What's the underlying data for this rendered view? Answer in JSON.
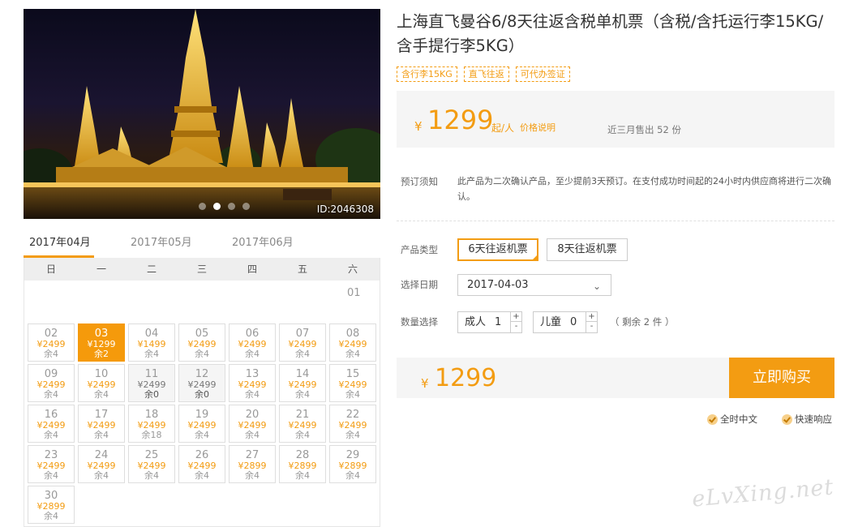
{
  "hero": {
    "id_label": "ID:2046308",
    "dot_count": 4,
    "active_dot": 1
  },
  "calendar": {
    "tabs": [
      "2017年04月",
      "2017年05月",
      "2017年06月"
    ],
    "active_tab": 0,
    "weekdays": [
      "日",
      "一",
      "二",
      "三",
      "四",
      "五",
      "六"
    ],
    "first_day": "01",
    "days": [
      {
        "d": "02",
        "p": "¥2499",
        "r": "余4"
      },
      {
        "d": "03",
        "p": "¥1299",
        "r": "余2",
        "state": "selected"
      },
      {
        "d": "04",
        "p": "¥1499",
        "r": "余4"
      },
      {
        "d": "05",
        "p": "¥2499",
        "r": "余4"
      },
      {
        "d": "06",
        "p": "¥2499",
        "r": "余4"
      },
      {
        "d": "07",
        "p": "¥2499",
        "r": "余4"
      },
      {
        "d": "08",
        "p": "¥2499",
        "r": "余4"
      },
      {
        "d": "09",
        "p": "¥2499",
        "r": "余4"
      },
      {
        "d": "10",
        "p": "¥2499",
        "r": "余4"
      },
      {
        "d": "11",
        "p": "¥2499",
        "r": "余0",
        "state": "soldout"
      },
      {
        "d": "12",
        "p": "¥2499",
        "r": "余0",
        "state": "soldout"
      },
      {
        "d": "13",
        "p": "¥2499",
        "r": "余4"
      },
      {
        "d": "14",
        "p": "¥2499",
        "r": "余4"
      },
      {
        "d": "15",
        "p": "¥2499",
        "r": "余4"
      },
      {
        "d": "16",
        "p": "¥2499",
        "r": "余4"
      },
      {
        "d": "17",
        "p": "¥2499",
        "r": "余4"
      },
      {
        "d": "18",
        "p": "¥2499",
        "r": "余18"
      },
      {
        "d": "19",
        "p": "¥2499",
        "r": "余4"
      },
      {
        "d": "20",
        "p": "¥2499",
        "r": "余4"
      },
      {
        "d": "21",
        "p": "¥2499",
        "r": "余4"
      },
      {
        "d": "22",
        "p": "¥2499",
        "r": "余4"
      },
      {
        "d": "23",
        "p": "¥2499",
        "r": "余4"
      },
      {
        "d": "24",
        "p": "¥2499",
        "r": "余4"
      },
      {
        "d": "25",
        "p": "¥2499",
        "r": "余4"
      },
      {
        "d": "26",
        "p": "¥2499",
        "r": "余4"
      },
      {
        "d": "27",
        "p": "¥2899",
        "r": "余4"
      },
      {
        "d": "28",
        "p": "¥2899",
        "r": "余4"
      },
      {
        "d": "29",
        "p": "¥2899",
        "r": "余4"
      },
      {
        "d": "30",
        "p": "¥2899",
        "r": "余4"
      }
    ]
  },
  "product": {
    "title": "上海直飞曼谷6/8天往返含税单机票（含税/含托运行李15KG/含手提行李5KG）",
    "tags": [
      "含行李15KG",
      "直飞往返",
      "可代办签证"
    ],
    "currency": "¥",
    "price": "1299",
    "price_unit": "起/人",
    "price_note": "价格说明",
    "sold": "近三月售出 52 份"
  },
  "booking": {
    "notice_label": "预订须知",
    "notice_text": "此产品为二次确认产品，至少提前3天预订。在支付成功时间起的24小时内供应商将进行二次确认。",
    "type_label": "产品类型",
    "types": [
      "6天往返机票",
      "8天往返机票"
    ],
    "active_type": 0,
    "date_label": "选择日期",
    "date_value": "2017-04-03",
    "qty_label": "数量选择",
    "adult_label": "成人",
    "adult_value": "1",
    "child_label": "儿童",
    "child_value": "0",
    "plus": "+",
    "minus": "-",
    "remain": "（ 剩余 2 件 ）",
    "total_price": "1299",
    "buy_label": "立即购买"
  },
  "features": [
    "全时中文",
    "快速响应"
  ],
  "watermark": "eLvXing.net",
  "colors": {
    "accent": "#f39c12",
    "selected_day": "#f59a0b",
    "panel_bg": "#f5f5f5"
  }
}
